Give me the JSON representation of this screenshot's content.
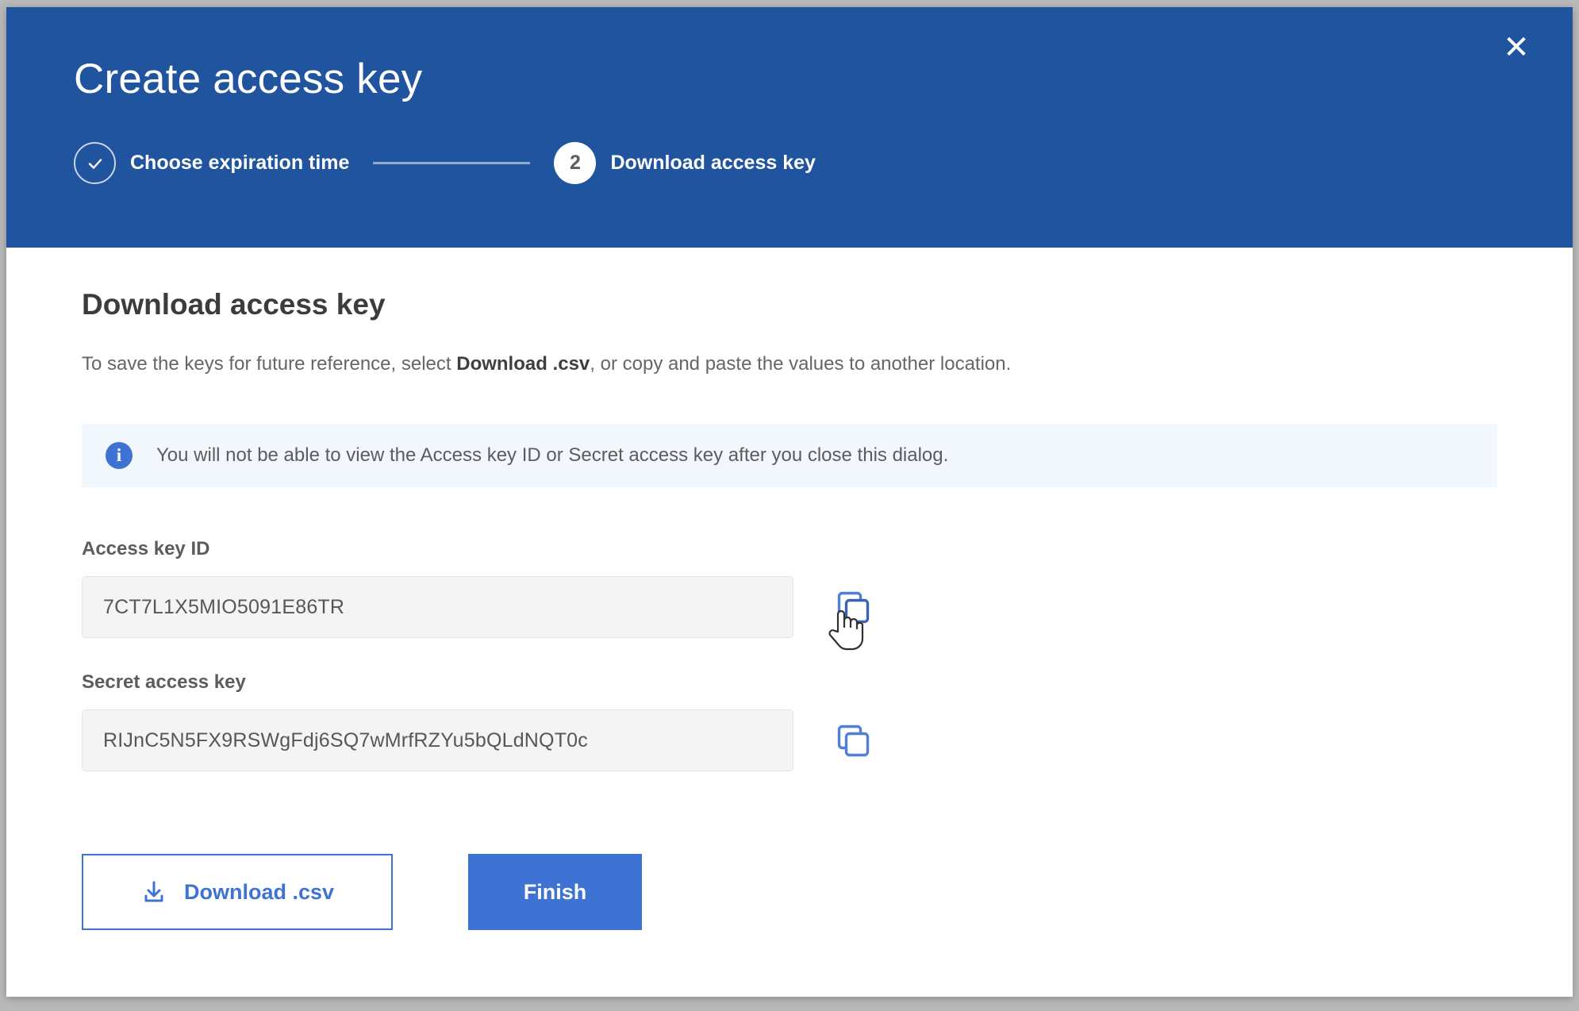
{
  "dialog": {
    "title": "Create access key",
    "close_label": "✕",
    "close_icon": "close-icon"
  },
  "stepper": {
    "steps": [
      {
        "marker": "✓",
        "label": "Choose expiration time",
        "state": "done"
      },
      {
        "marker": "2",
        "label": "Download access key",
        "state": "current"
      }
    ]
  },
  "main": {
    "section_title": "Download access key",
    "desc_part1": "To save the keys for future reference, select ",
    "desc_emphasis": "Download .csv",
    "desc_part2": ", or copy and paste the values to another location.",
    "alert": {
      "icon": "info-icon",
      "icon_glyph": "i",
      "text": "You will not be able to view the Access key ID or Secret access key after you close this dialog."
    },
    "fields": [
      {
        "label": "Access key ID",
        "value": "7CT7L1X5MIO5091E86TR",
        "copy_icon": "copy-icon"
      },
      {
        "label": "Secret access key",
        "value": "RIJnC5N5FX9RSWgFdj6SQ7wMrfRZYu5bQLdNQT0c",
        "copy_icon": "copy-icon"
      }
    ],
    "actions": {
      "download_label": "Download .csv",
      "download_icon": "download-icon",
      "finish_label": "Finish"
    }
  },
  "colors": {
    "header_blue": "#21549F",
    "accent_blue": "#3E73D4",
    "alert_bg": "#F2F6FD",
    "input_bg": "#F4F4F4",
    "page_bg": "#B9B9B9"
  }
}
